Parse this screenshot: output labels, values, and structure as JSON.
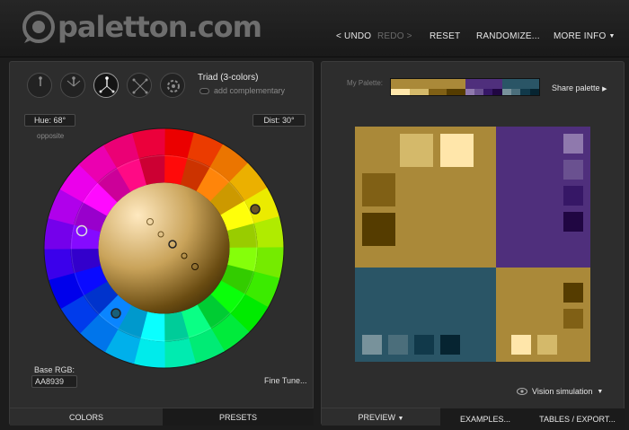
{
  "header": {
    "logo_text": "paletton.com",
    "nav": {
      "undo": "< UNDO",
      "redo": "REDO >",
      "reset": "RESET",
      "randomize": "RANDOMIZE...",
      "more_info": "MORE INFO"
    }
  },
  "colors_panel": {
    "scheme_icons": [
      "mono-icon",
      "adjacent-icon",
      "triad-icon",
      "tetrad-icon",
      "free-style-icon"
    ],
    "scheme_title": "Triad (3-colors)",
    "add_complementary": "add complementary",
    "hue_label": "Hue: 68°",
    "opposite_label": "opposite",
    "dist_label": "Dist: 30°",
    "base_rgb_label": "Base RGB:",
    "base_rgb_value": "AA8939",
    "fine_tune": "Fine Tune...",
    "tab_colors": "COLORS",
    "tab_presets": "PRESETS"
  },
  "palette_panel": {
    "my_palette_label": "My Palette:",
    "share_palette": "Share palette",
    "vision_simulation": "Vision simulation",
    "tab_preview": "PREVIEW",
    "tab_examples": "EXAMPLES...",
    "tab_tables": "TABLES / EXPORT..."
  },
  "palette": {
    "primary": [
      "#AA8939",
      "#FFE6AA",
      "#D4B96A",
      "#806015",
      "#553C00"
    ],
    "secondary": [
      "#4F2F7C",
      "#8F79AD",
      "#6A5190",
      "#361766",
      "#200642"
    ],
    "tertiary": [
      "#2A5566",
      "#78929B",
      "#4B6E7B",
      "#11394A",
      "#062431"
    ]
  }
}
